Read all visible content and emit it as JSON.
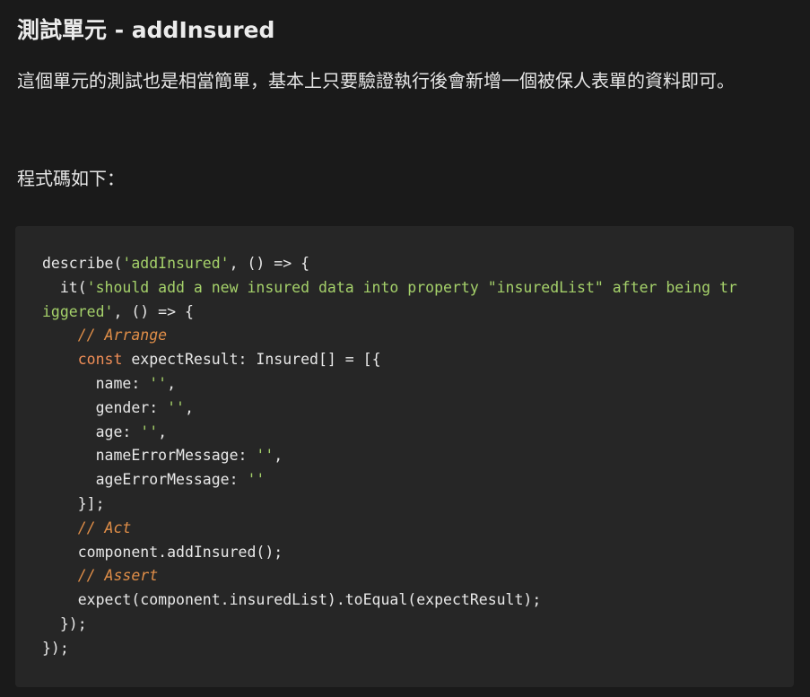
{
  "heading": "測試單元 - addInsured",
  "paragraph1": "這個單元的測試也是相當簡單，基本上只要驗證執行後會新增一個被保人表單的資料即可。",
  "paragraph2": "程式碼如下：",
  "colors": {
    "background": "#1a1a1a",
    "code_background": "#262626",
    "string": "#a5d16a",
    "keyword": "#f08e57",
    "comment": "#e08e48",
    "text": "#e8e8e8"
  },
  "code_lines": [
    [
      {
        "t": "describe(",
        "c": "pl"
      },
      {
        "t": "'addInsured'",
        "c": "str"
      },
      {
        "t": ", () => {",
        "c": "pl"
      }
    ],
    [
      {
        "t": "  it(",
        "c": "pl"
      },
      {
        "t": "'should add a new insured data into property \"insuredList\" after being tr",
        "c": "str"
      }
    ],
    [
      {
        "t": "iggered'",
        "c": "str"
      },
      {
        "t": ", () => {",
        "c": "pl"
      }
    ],
    [
      {
        "t": "    ",
        "c": "pl"
      },
      {
        "t": "// Arrange",
        "c": "cmt"
      }
    ],
    [
      {
        "t": "    ",
        "c": "pl"
      },
      {
        "t": "const",
        "c": "kw"
      },
      {
        "t": " expectResult: Insured[] = [{",
        "c": "pl"
      }
    ],
    [
      {
        "t": "      name: ",
        "c": "pl"
      },
      {
        "t": "''",
        "c": "str"
      },
      {
        "t": ",",
        "c": "pl"
      }
    ],
    [
      {
        "t": "      gender: ",
        "c": "pl"
      },
      {
        "t": "''",
        "c": "str"
      },
      {
        "t": ",",
        "c": "pl"
      }
    ],
    [
      {
        "t": "      age: ",
        "c": "pl"
      },
      {
        "t": "''",
        "c": "str"
      },
      {
        "t": ",",
        "c": "pl"
      }
    ],
    [
      {
        "t": "      nameErrorMessage: ",
        "c": "pl"
      },
      {
        "t": "''",
        "c": "str"
      },
      {
        "t": ",",
        "c": "pl"
      }
    ],
    [
      {
        "t": "      ageErrorMessage: ",
        "c": "pl"
      },
      {
        "t": "''",
        "c": "str"
      }
    ],
    [
      {
        "t": "    }];",
        "c": "pl"
      }
    ],
    [
      {
        "t": "    ",
        "c": "pl"
      },
      {
        "t": "// Act",
        "c": "cmt"
      }
    ],
    [
      {
        "t": "    component.addInsured();",
        "c": "pl"
      }
    ],
    [
      {
        "t": "    ",
        "c": "pl"
      },
      {
        "t": "// Assert",
        "c": "cmt"
      }
    ],
    [
      {
        "t": "    expect(component.insuredList).toEqual(expectResult);",
        "c": "pl"
      }
    ],
    [
      {
        "t": "  });",
        "c": "pl"
      }
    ],
    [
      {
        "t": "});",
        "c": "pl"
      }
    ]
  ]
}
